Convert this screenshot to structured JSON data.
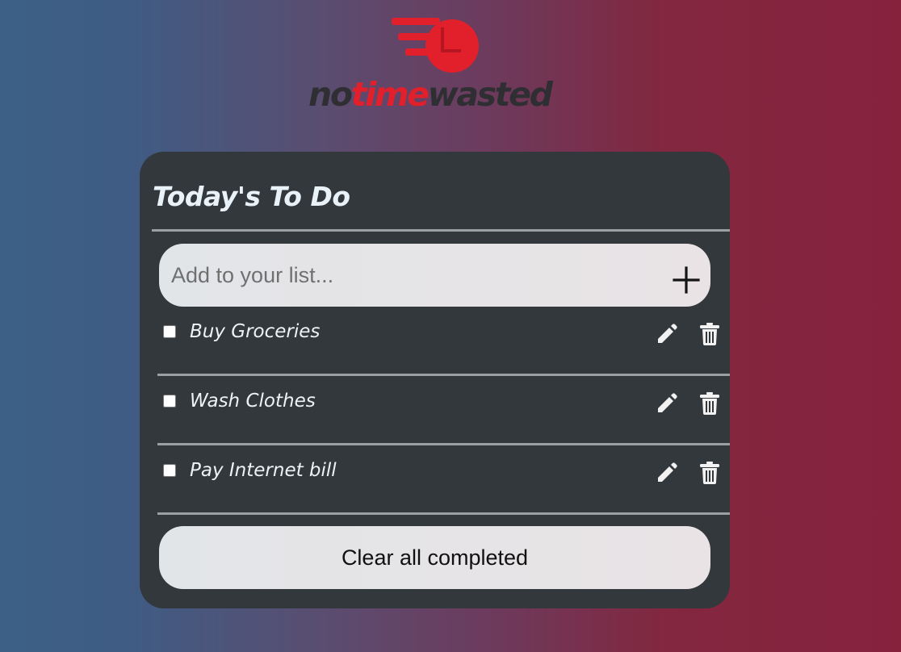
{
  "brand": {
    "logo_parts": [
      "no",
      "time",
      "wasted"
    ],
    "colors": {
      "red": "#e2202b",
      "dark": "#2f2f33"
    }
  },
  "todo_card": {
    "title": "Today's To Do",
    "add_input": {
      "placeholder": "Add to your list...",
      "value": ""
    },
    "add_button_icon": "plus-icon",
    "items": [
      {
        "label": "Buy Groceries",
        "checked": false
      },
      {
        "label": "Wash Clothes",
        "checked": false
      },
      {
        "label": "Pay Internet bill",
        "checked": false
      }
    ],
    "item_icons": [
      "pencil-icon",
      "trash-icon"
    ],
    "clear_button_label": "Clear all completed"
  },
  "colors": {
    "background_left": "#3c6086",
    "background_right": "#87223d",
    "card": "#33383c",
    "text_light": "#eef2f5"
  }
}
